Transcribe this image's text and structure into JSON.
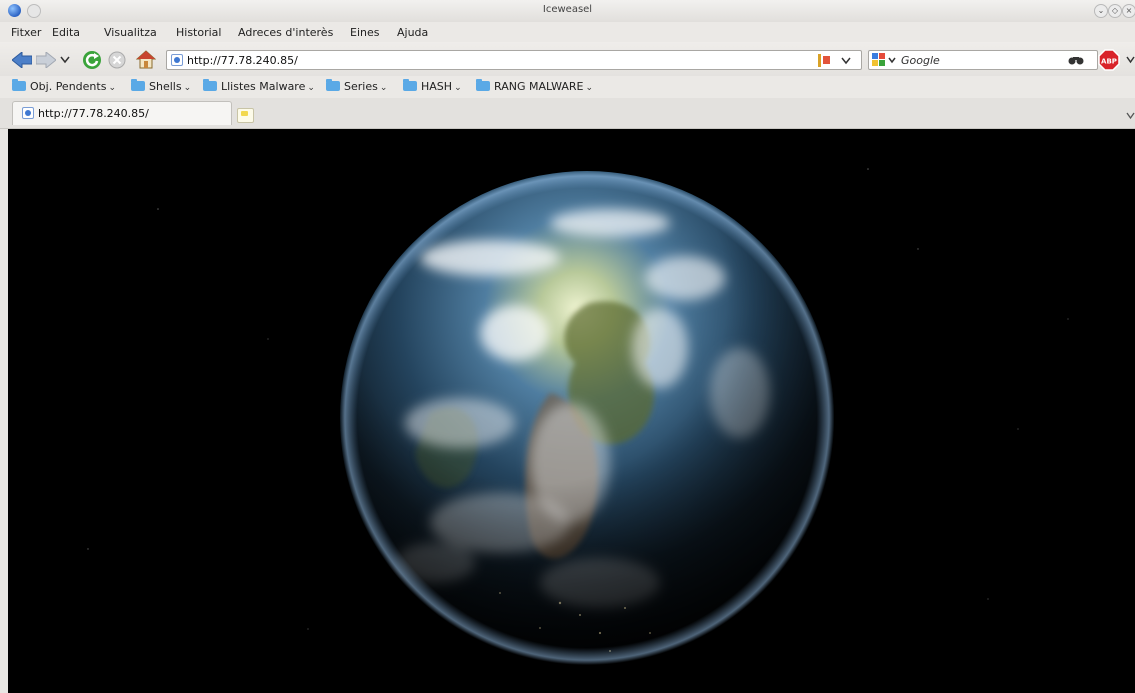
{
  "window": {
    "title": "Iceweasel"
  },
  "menu": {
    "items": [
      "Fitxer",
      "Edita",
      "Visualitza",
      "Historial",
      "Adreces d'interès",
      "Eines",
      "Ajuda"
    ]
  },
  "nav": {
    "url": "http://77.78.240.85/",
    "search_placeholder": "Google",
    "adblock_label": "ABP"
  },
  "bookmarks": {
    "items": [
      "Obj. Pendents",
      "Shells",
      "Llistes Malware",
      "Series",
      "HASH",
      "RANG MALWARE"
    ]
  },
  "tabs": {
    "items": [
      {
        "label": "http://77.78.240.85/"
      }
    ]
  },
  "colors": {
    "folder": "#5aa9e6",
    "reload": "#3aa33a",
    "adblock": "#d9232a"
  }
}
